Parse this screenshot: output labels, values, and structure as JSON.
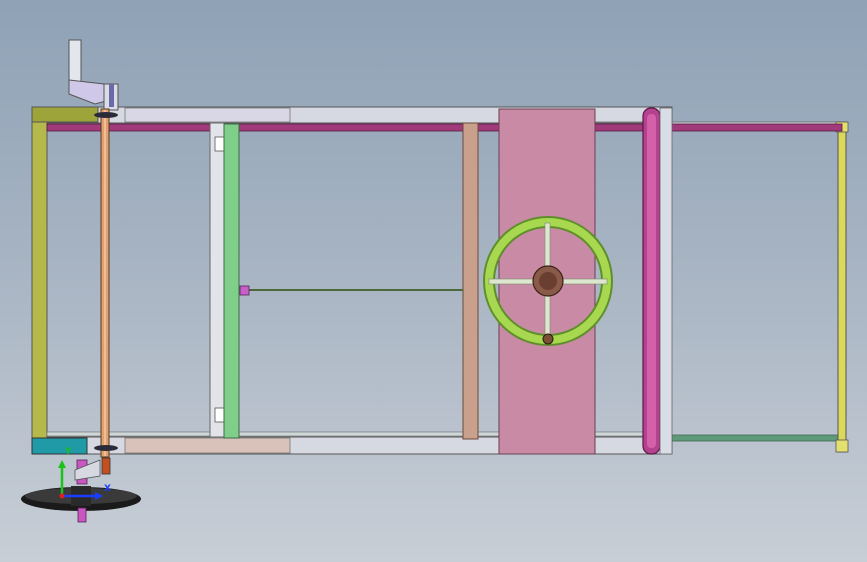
{
  "colors": {
    "background_top": "#8fa2b6",
    "background_bottom": "#c8ced6",
    "frame_gray": "#d6d8e2",
    "rod_magenta": "#a03a7a",
    "olive_bar": "#b5b84a",
    "teal_block": "#1f9aa6",
    "green_crossbar": "#7fcf8a",
    "tan_crossbar": "#c9a08c",
    "pink_plate": "#c98aa6",
    "handwheel_green": "#9fd04a",
    "shaft_orange": "#e0a070",
    "tire_black": "#222222",
    "axis_x": "#1a3cff",
    "axis_y": "#19c219",
    "axis_z": "#e02020"
  },
  "triad": {
    "y_label": "Y",
    "x_label": "X",
    "icon": "coordinate-triad-icon"
  }
}
